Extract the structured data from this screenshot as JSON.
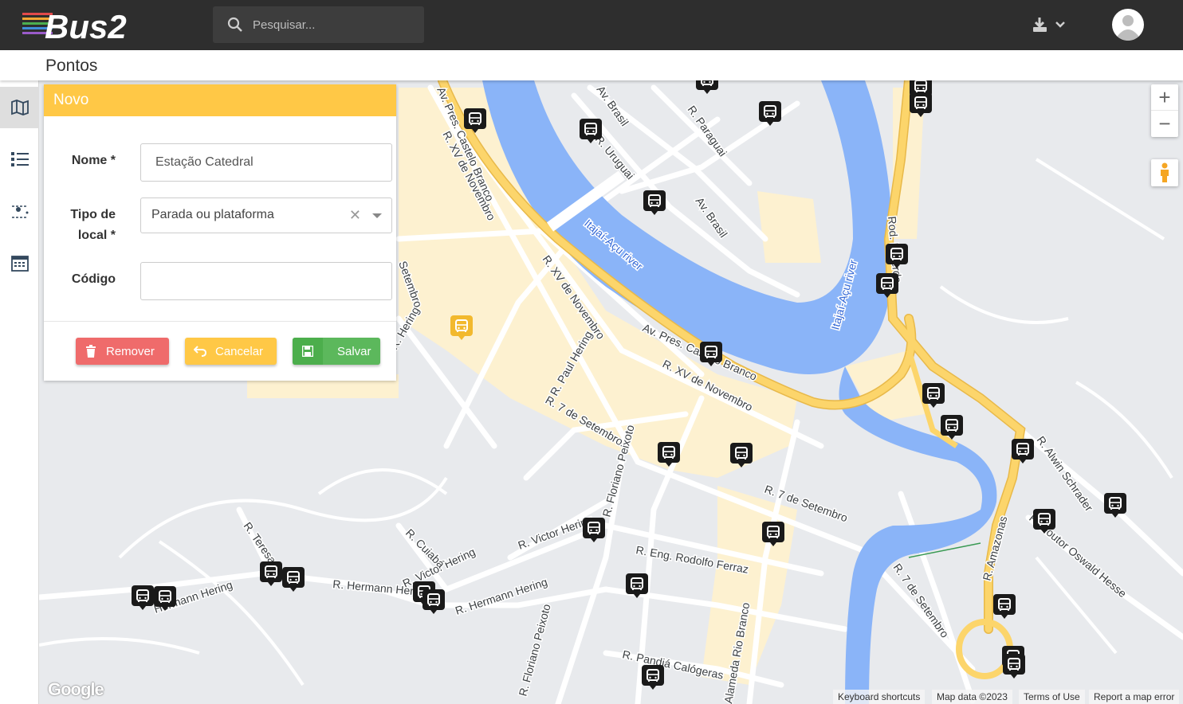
{
  "app": {
    "logo_text": "Bus2",
    "search_placeholder": "Pesquisar..."
  },
  "header": {
    "download_icon": "download-icon",
    "user_icon": "user-icon"
  },
  "page": {
    "title": "Pontos"
  },
  "sidebar": [
    {
      "icon": "map-icon",
      "active": true
    },
    {
      "icon": "list-icon",
      "active": false
    },
    {
      "icon": "route-icon",
      "active": false
    },
    {
      "icon": "calendar-icon",
      "active": false
    }
  ],
  "form": {
    "header": "Novo",
    "name_label": "Nome *",
    "name_value": "Estação Catedral",
    "type_label_line1": "Tipo de",
    "type_label_line2": "local *",
    "type_value": "Parada ou plataforma",
    "code_label": "Código",
    "code_value": "",
    "remove_label": "Remover",
    "cancel_label": "Cancelar",
    "save_label": "Salvar"
  },
  "map": {
    "labels": [
      "Av. Pres. Castelo Branco",
      "R. XV de Novembro",
      "R. XV de Novembro",
      "R. XV de Novembro",
      "R. 7 de Setembro",
      "R. 7 de Setembro",
      "R. 7 de Setembro",
      "Itajaí-Açu river",
      "Itajaí-Açu river",
      "Av. Pres. Castelo Branco",
      "R. Paul Hering",
      "R. Victor Hering",
      "R. Victor Hering",
      "R. Hermann Hering",
      "R. Hermann Hering",
      "Hermann Hering",
      "R. Eng. Rodolfo Ferraz",
      "R. Pandiá Calógeras",
      "R. Floriano Peixoto",
      "R. Floriano Peixoto",
      "Alameda Rio Branco",
      "R. Amazonas",
      "R. Alwin Schrader",
      "R. Doutor Oswald Hesse",
      "Rod. Lacerda",
      "Av. Brasil",
      "Av. Brasil",
      "R. Paraguai",
      "R. Uruguai",
      "R. Cuiabá",
      "R. Teresa",
      "R. Hering",
      "Setembro"
    ],
    "zoom_in": "+",
    "zoom_out": "−",
    "attribution": {
      "shortcuts": "Keyboard shortcuts",
      "data": "Map data ©2023",
      "terms": "Terms of Use",
      "report": "Report a map error"
    },
    "google": "Google",
    "stop_count": 33,
    "colors": {
      "road_major": "#fcd56b",
      "water": "#8ab4f8",
      "land": "#e8eaed",
      "urban": "#fdf1d0",
      "marker": "#1a1a1a",
      "marker_selected": "#f2b92e"
    }
  }
}
